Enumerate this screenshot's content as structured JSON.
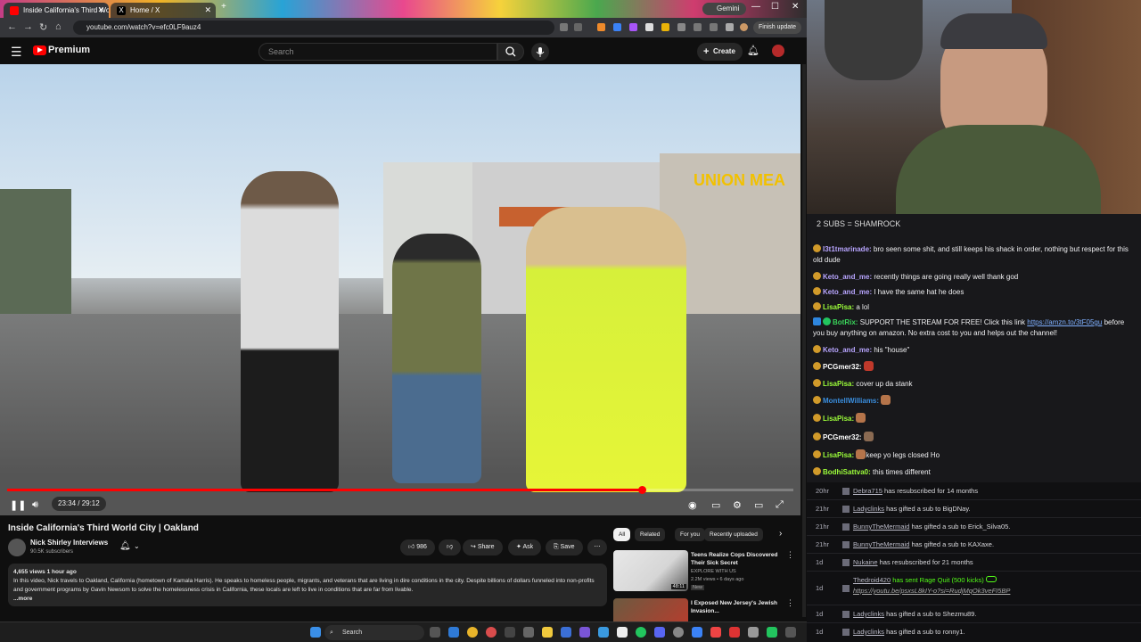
{
  "browser": {
    "tabs": [
      {
        "title": "Inside California's Third Wo"
      },
      {
        "title": "Home / X"
      }
    ],
    "gemini_label": "Gemini",
    "url": "youtube.com/watch?v=efc0LF9auz4",
    "finish_update": "Finish update"
  },
  "youtube": {
    "logo_text": "Premium",
    "search_placeholder": "Search",
    "create_label": "Create",
    "video": {
      "sign_text": "UNION MEA",
      "time": "23:34 / 29:12",
      "progress_fraction": 0.807
    },
    "title": "Inside California's Third World City | Oakland",
    "channel": {
      "name": "Nick Shirley Interviews",
      "subscribers": "90.5K subscribers"
    },
    "actions": {
      "likes": "986",
      "share": "Share",
      "ask": "Ask",
      "save": "Save"
    },
    "description": {
      "meta": "4,655 views  1 hour ago",
      "text": "In this video, Nick travels to Oakland, California (hometown of Kamala Harris). He speaks to homeless people, migrants, and veterans that are living in dire conditions in the city. Despite billions of dollars funneled into non-profits and government programs by Gavin Newsom to solve the homelessness crisis in California, these locals are left to live in conditions that are far from livable.",
      "more": "...more"
    },
    "chips": [
      "All",
      "Related",
      "For you",
      "Recently uploaded"
    ],
    "recommendations": [
      {
        "title": "Teens Realize Cops Discovered Their Sick Secret",
        "channel": "EXPLORE WITH US",
        "meta": "2.2M views • 6 days ago",
        "badge": "New",
        "duration": "48:11"
      },
      {
        "title": "I Exposed New Jersey's Jewish Invasion...",
        "channel": "",
        "meta": "",
        "badge": "",
        "duration": ""
      }
    ]
  },
  "taskbar": {
    "search": "Search"
  },
  "stream": {
    "goal_text": "2 SUBS = SHAMROCK",
    "chat": [
      {
        "user": "I3t1tmarinade:",
        "text": "bro seen some shit, and still keeps his shack in order, nothing but respect for this old dude",
        "color": "#b8a5ff"
      },
      {
        "user": "Keto_and_me:",
        "text": "recently things are going really well thank god",
        "color": "#b8a5ff"
      },
      {
        "user": "Keto_and_me:",
        "text": "I have the same hat he does",
        "color": "#b8a5ff"
      },
      {
        "user": "LisaPisa:",
        "text": "a lol",
        "color": "#9dff3a"
      },
      {
        "user": "BotRix:",
        "text": "SUPPORT THE STREAM FOR FREE! Click this link ",
        "link": "https://amzn.to/3tF05gu",
        "text2": "before you buy anything on amazon. No extra cost to you and helps out the channel!",
        "color": "#3ad45a"
      },
      {
        "user": "Keto_and_me:",
        "text": "his \"house\"",
        "color": "#b8a5ff"
      },
      {
        "user": "PCGmer32:",
        "text": "",
        "color": "#ffffff"
      },
      {
        "user": "LisaPisa:",
        "text": "cover up da stank",
        "color": "#9dff3a"
      },
      {
        "user": "MontellWilliams:",
        "text": "",
        "color": "#3a8fe0"
      },
      {
        "user": "LisaPisa:",
        "text": "",
        "color": "#9dff3a"
      },
      {
        "user": "PCGmer32:",
        "text": "",
        "color": "#ffffff"
      },
      {
        "user": "LisaPisa:",
        "text": "keep yo legs closed Ho",
        "color": "#9dff3a"
      },
      {
        "user": "BodhiSattva0:",
        "text": "this times different",
        "color": "#9dff3a"
      }
    ],
    "events": [
      {
        "time": "20hr",
        "name": "Debra715",
        "text": "has resubscribed for 14 months"
      },
      {
        "time": "21hr",
        "name": "Ladyclinks",
        "text": "has gifted a sub to BigDNay."
      },
      {
        "time": "21hr",
        "name": "BunnyTheMermaid",
        "text": "has gifted a sub to Erick_Silva05."
      },
      {
        "time": "21hr",
        "name": "BunnyTheMermaid",
        "text": "has gifted a sub to KAXaxe."
      },
      {
        "time": "1d",
        "name": "Nukaine",
        "text": "has resubscribed for 21 months"
      },
      {
        "time": "1d",
        "name": "Thedroid420",
        "text": "has sent Rage Quit (500 kicks)",
        "link": "https://youtu.be/psxsL8kIY-o?si=RudjMqOk3veFI5BP"
      },
      {
        "time": "1d",
        "name": "Ladyclinks",
        "text": "has gifted a sub to Shezmu89."
      },
      {
        "time": "1d",
        "name": "Ladyclinks",
        "text": "has gifted a sub to ronny1."
      }
    ]
  }
}
